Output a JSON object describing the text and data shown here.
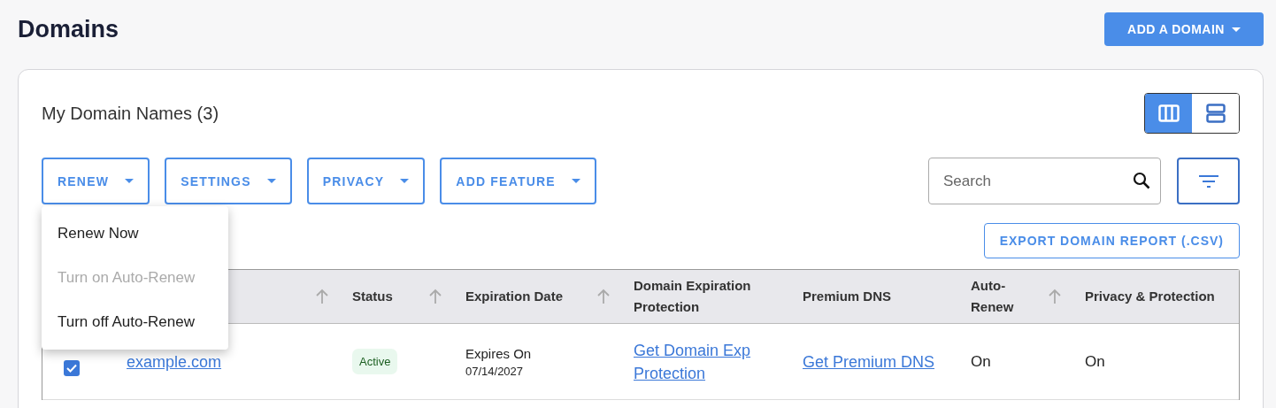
{
  "page": {
    "title": "Domains",
    "add_button": "ADD A DOMAIN"
  },
  "card": {
    "title": "My Domain Names (3)",
    "view_toggle": [
      {
        "kind": "columns",
        "selected": true
      },
      {
        "kind": "rows",
        "selected": false
      }
    ],
    "actions": [
      {
        "label": "RENEW",
        "menu": [
          {
            "label": "Renew Now",
            "disabled": false
          },
          {
            "label": "Turn on Auto-Renew",
            "disabled": true
          },
          {
            "label": "Turn off Auto-Renew",
            "disabled": false
          }
        ]
      },
      {
        "label": "SETTINGS"
      },
      {
        "label": "PRIVACY"
      },
      {
        "label": "ADD FEATURE"
      }
    ],
    "search": {
      "placeholder": "Search"
    },
    "export_button": "EXPORT DOMAIN REPORT (.CSV)",
    "table": {
      "columns": [
        {
          "kind": "select"
        },
        {
          "kind": "text",
          "sortable": true
        },
        {
          "kind": "text",
          "label": "Status",
          "sortable": true
        },
        {
          "kind": "text",
          "label": "Expiration Date",
          "sortable": true
        },
        {
          "kind": "text",
          "label": "Domain Expiration Protection",
          "sortable": false
        },
        {
          "kind": "text",
          "label": "Premium DNS",
          "sortable": false
        },
        {
          "kind": "text",
          "label": "Auto-Renew",
          "sortable": true
        },
        {
          "kind": "text",
          "label": "Privacy & Protection",
          "sortable": false
        }
      ],
      "rows": [
        {
          "checked": true,
          "domain": "example.com",
          "status": "Active",
          "expires_label": "Expires On",
          "expires_date": "07/14/2027",
          "protection_link": "Get Domain Exp Protection",
          "dns_link": "Get Premium DNS",
          "auto_renew": "On",
          "privacy": "On"
        }
      ]
    }
  }
}
